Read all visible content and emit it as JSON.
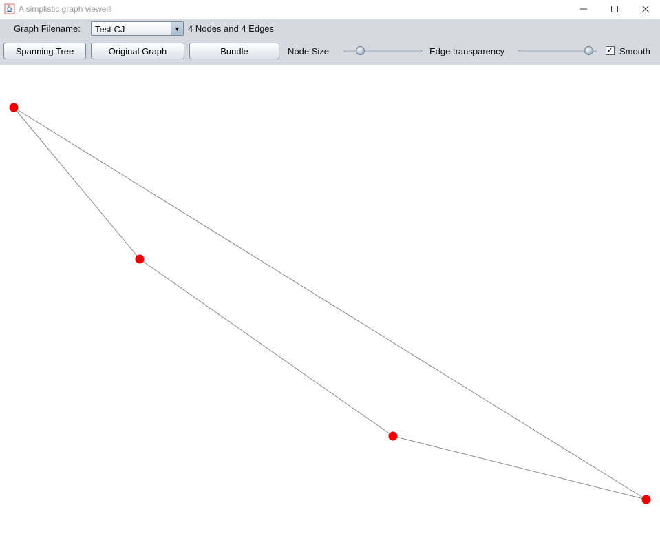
{
  "window": {
    "title": "A simplistic graph viewer!"
  },
  "toolbar": {
    "filename_label": "Graph Filename:",
    "filename_value": "Test CJ",
    "graph_info": "4 Nodes and 4 Edges",
    "spanning_tree_label": "Spanning Tree",
    "original_graph_label": "Original Graph",
    "bundle_label": "Bundle",
    "node_size_label": "Node Size",
    "node_size_level": 0.18,
    "edge_transparency_label": "Edge transparency",
    "edge_transparency_level": 0.95,
    "smooth_label": "Smooth",
    "smooth_checked": true
  },
  "graph": {
    "node_color": "#ee0000",
    "edge_color": "#888888",
    "nodes": [
      {
        "id": "n1"
      },
      {
        "id": "n2"
      },
      {
        "id": "n3"
      },
      {
        "id": "n4"
      }
    ],
    "edges": [
      {
        "from": "n1",
        "to": "n2"
      },
      {
        "from": "n1",
        "to": "n4"
      },
      {
        "from": "n2",
        "to": "n3"
      },
      {
        "from": "n3",
        "to": "n4"
      }
    ]
  },
  "icons": {
    "app": "java-cup-icon",
    "minimize": "minimize-icon",
    "maximize": "maximize-icon",
    "close": "close-icon",
    "dropdown": "chevron-down-icon",
    "checkmark": "check-icon"
  }
}
